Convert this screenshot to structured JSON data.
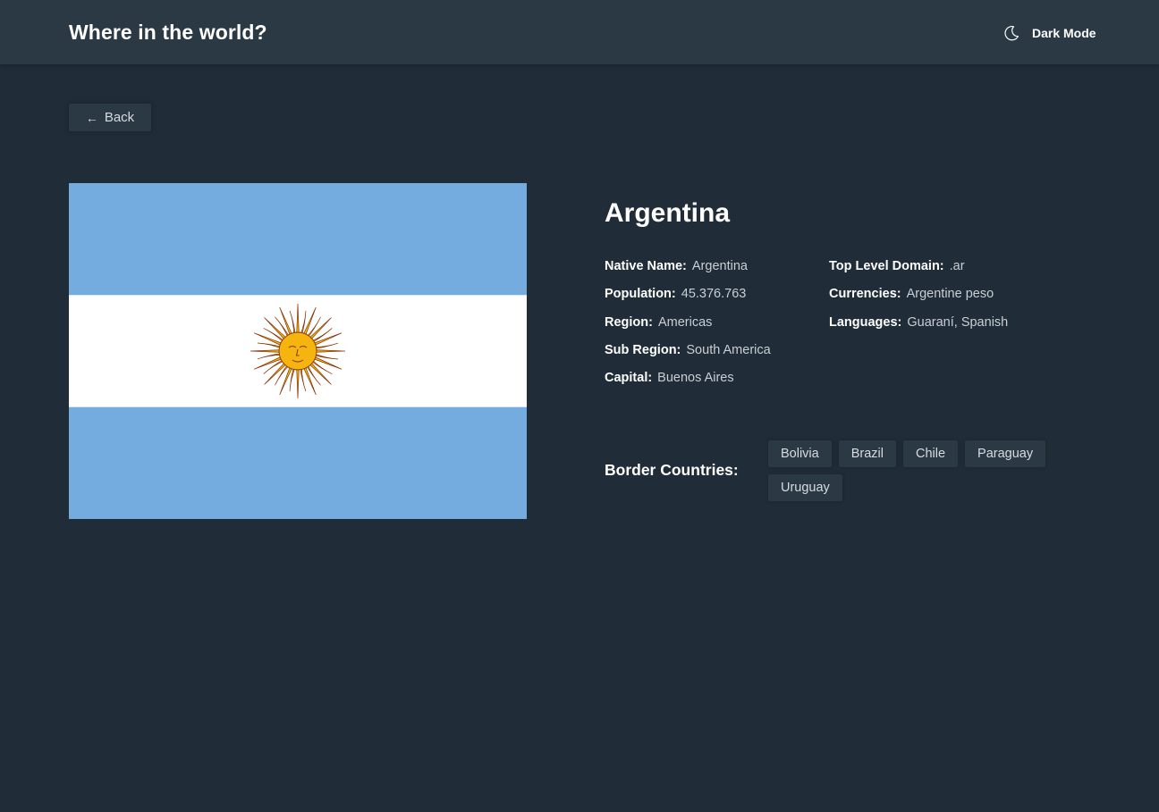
{
  "header": {
    "title": "Where in the world?",
    "mode_label": "Dark Mode",
    "mode_icon": "moon-icon"
  },
  "back_button": {
    "label": "Back",
    "icon": "arrow-left-icon"
  },
  "flag": {
    "country": "Argentina",
    "colors": {
      "blue": "#74acdf",
      "white": "#ffffff",
      "sun": "#f6b40e",
      "sun_outline": "#85340a"
    }
  },
  "country": {
    "name": "Argentina",
    "details_left": [
      {
        "label": "Native Name:",
        "value": "Argentina"
      },
      {
        "label": "Population:",
        "value": "45.376.763"
      },
      {
        "label": "Region:",
        "value": "Americas"
      },
      {
        "label": "Sub Region:",
        "value": "South America"
      },
      {
        "label": "Capital:",
        "value": "Buenos Aires"
      }
    ],
    "details_right": [
      {
        "label": "Top Level Domain:",
        "value": ".ar"
      },
      {
        "label": "Currencies:",
        "value": "Argentine peso"
      },
      {
        "label": "Languages:",
        "value": "Guaraní, Spanish"
      }
    ],
    "border_label": "Border Countries:",
    "borders": [
      "Bolivia",
      "Brazil",
      "Chile",
      "Paraguay",
      "Uruguay"
    ]
  },
  "theme": {
    "background": "#202c37",
    "element": "#2b3945",
    "text": "#ffffff"
  }
}
